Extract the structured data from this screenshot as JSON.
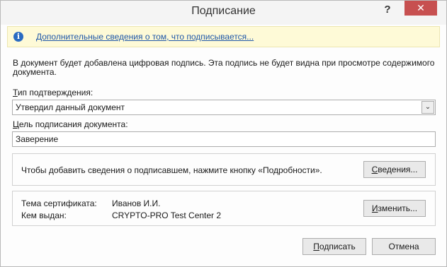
{
  "window": {
    "title": "Подписание",
    "help_label": "?",
    "close_label": "✕"
  },
  "infobar": {
    "icon": "info-icon",
    "icon_glyph": "i",
    "link_text": "Дополнительные сведения о том, что подписывается..."
  },
  "description": "В документ будет добавлена цифровая подпись. Эта подпись не будет видна при просмотре содержимого документа.",
  "commitment": {
    "label_accel": "Т",
    "label_rest": "ип подтверждения:",
    "selected_value": "Утвердил данный документ",
    "arrow_glyph": "⌄"
  },
  "purpose": {
    "label_accel": "Ц",
    "label_rest": "ель подписания документа:",
    "value": "Заверение"
  },
  "signer_info": {
    "hint": "Чтобы добавить сведения о подписавшем, нажмите кнопку «Подробности».",
    "details_button_accel": "С",
    "details_button_rest": "ведения..."
  },
  "certificate": {
    "subject_label": "Тема сертификата:",
    "subject_value": "Иванов И.И.",
    "issuer_label": "Кем выдан:",
    "issuer_value": "CRYPTO-PRO Test Center 2",
    "change_button_accel": "И",
    "change_button_rest": "зменить..."
  },
  "footer": {
    "sign_button_accel": "П",
    "sign_button_rest": "одписать",
    "cancel_button": "Отмена"
  },
  "colors": {
    "close_button": "#c75050",
    "infobar_bg": "#fefad7",
    "link": "#1f57a8",
    "info_icon": "#2a6bc2"
  }
}
